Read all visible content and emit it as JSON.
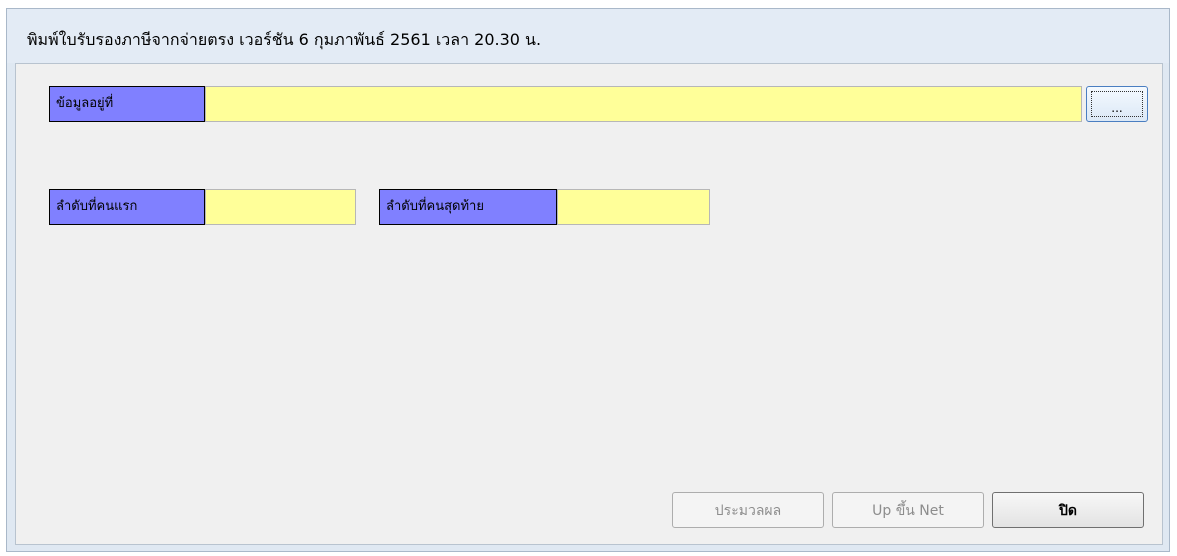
{
  "window": {
    "title": "พิมพ์ใบรับรองภาษีจากจ่ายตรง  เวอร์ชัน 6 กุมภาพันธ์ 2561 เวลา 20.30 น."
  },
  "form": {
    "data_location": {
      "label": "ข้อมูลอยู่ที่",
      "value": "",
      "browse_label": "..."
    },
    "first_order": {
      "label": "ลำดับที่คนแรก",
      "value": ""
    },
    "last_order": {
      "label": "ลำดับที่คนสุดท้าย",
      "value": ""
    }
  },
  "buttons": {
    "process": "ประมวลผล",
    "upload_net": "Up ขึ้น Net",
    "close": "ปิด"
  },
  "colors": {
    "label_background": "#8080ff",
    "field_background": "#ffff99"
  }
}
